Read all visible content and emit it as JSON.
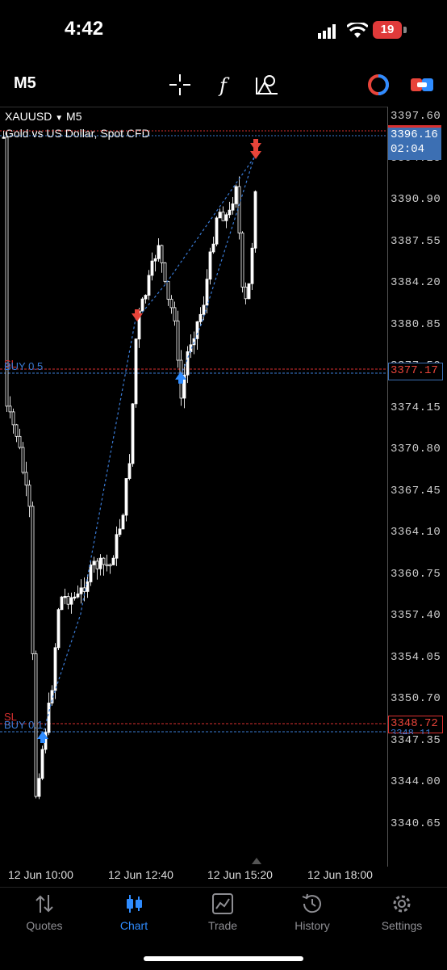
{
  "status_bar": {
    "time": "4:42",
    "battery": "19"
  },
  "toolbar": {
    "timeframe": "M5"
  },
  "chart_header": {
    "symbol": "XAUUSD",
    "timeframe": "M5",
    "description": "Gold vs US Dollar, Spot CFD"
  },
  "price_axis": [
    "3397.60",
    "3394.25",
    "3390.90",
    "3387.55",
    "3384.20",
    "3380.85",
    "3377.50",
    "3374.15",
    "3370.80",
    "3367.45",
    "3364.10",
    "3360.75",
    "3357.40",
    "3354.05",
    "3350.70",
    "3347.35",
    "3344.00",
    "3340.65"
  ],
  "time_axis": [
    "12 Jun 10:00",
    "12 Jun 12:40",
    "12 Jun 15:20",
    "12 Jun 18:00"
  ],
  "bid": {
    "price": "3396.16",
    "timer": "02:04"
  },
  "orders": [
    {
      "sl_label": "SL",
      "buy_label": "BUY 0.5",
      "level_price": "3377.17"
    },
    {
      "sl_label": "SL",
      "buy_label": "BUY 0.1",
      "level_price": "3348.72",
      "under_price": "3348.11"
    }
  ],
  "colors": {
    "up_arrow": "#2f8cff",
    "down_arrow": "#e8443a",
    "bid_box": "#3c6fb3",
    "sl_line": "#d83030",
    "buy_line": "#3a7bd5"
  },
  "nav": [
    {
      "label": "Quotes",
      "icon": "quotes-arrows-icon",
      "active": false
    },
    {
      "label": "Chart",
      "icon": "chart-candles-icon",
      "active": true
    },
    {
      "label": "Trade",
      "icon": "trade-chart-icon",
      "active": false
    },
    {
      "label": "History",
      "icon": "history-clock-icon",
      "active": false
    },
    {
      "label": "Settings",
      "icon": "settings-gear-icon",
      "active": false
    }
  ]
}
